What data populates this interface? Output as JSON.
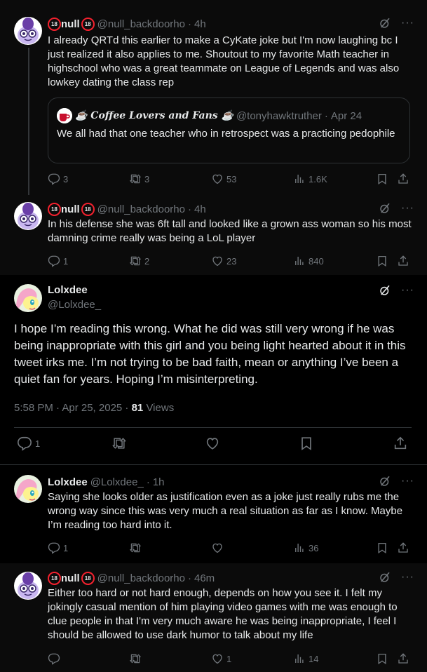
{
  "colors": {
    "background": "#000000",
    "text": "#e7e9ea",
    "muted": "#71767b",
    "border": "#2f3336",
    "badge": "#f4212e"
  },
  "tweet1": {
    "name": "null",
    "badge": "18",
    "handle": "@null_backdoorho",
    "time": "4h",
    "text": "I already QRTd this earlier to make a CyKate joke but I'm now laughing bc I just realized it also applies to me. Shoutout to my favorite Math teacher in highschool who was a great teammate on League of Legends and was also lowkey dating the class rep",
    "quote": {
      "name": "☕ Coffee Lovers and Fans ☕",
      "handle": "@tonyhawktruther",
      "time": "Apr 24",
      "text": "We all had that one teacher who in retrospect was a practicing pedophile"
    },
    "replies": "3",
    "reposts": "3",
    "likes": "53",
    "views": "1.6K"
  },
  "tweet2": {
    "name": "null",
    "badge": "18",
    "handle": "@null_backdoorho",
    "time": "4h",
    "text": "In his defense she was 6ft tall and looked like a grown ass woman so his most damning crime really was being a LoL player",
    "replies": "1",
    "reposts": "2",
    "likes": "23",
    "views": "840"
  },
  "main": {
    "name": "Lolxdee",
    "handle": "@Lolxdee_",
    "text": "I hope I’m reading this wrong. What he did was still very wrong if he was being inappropriate with this girl and you being light hearted about it in this tweet irks me. I’m not trying to be bad faith, mean or anything I’ve been a quiet fan for years. Hoping I’m misinterpreting.",
    "timestamp": "5:58 PM · Apr 25, 2025 · ",
    "views_count": "81",
    "views_label": " Views",
    "replies": "1"
  },
  "tweet3": {
    "name": "Lolxdee",
    "handle": "@Lolxdee_",
    "time": "1h",
    "text": "Saying she looks older as justification even as a joke just really rubs me the wrong way since this was very much a real situation as far as I know. Maybe I’m reading too hard into it.",
    "replies": "1",
    "views": "36"
  },
  "tweet4": {
    "name": "null",
    "badge": "18",
    "handle": "@null_backdoorho",
    "time": "46m",
    "text": "Either too hard or not hard enough, depends on how you see it. I felt my jokingly casual mention of him playing video games with me was enough to clue people in that I'm very much aware he was being inappropriate, I feel I should be allowed to use dark humor to talk about my life",
    "likes": "1",
    "views": "14"
  },
  "icons": [
    "reply-icon",
    "repost-icon",
    "like-icon",
    "views-icon",
    "bookmark-icon",
    "share-icon",
    "grok-icon",
    "more-icon"
  ]
}
